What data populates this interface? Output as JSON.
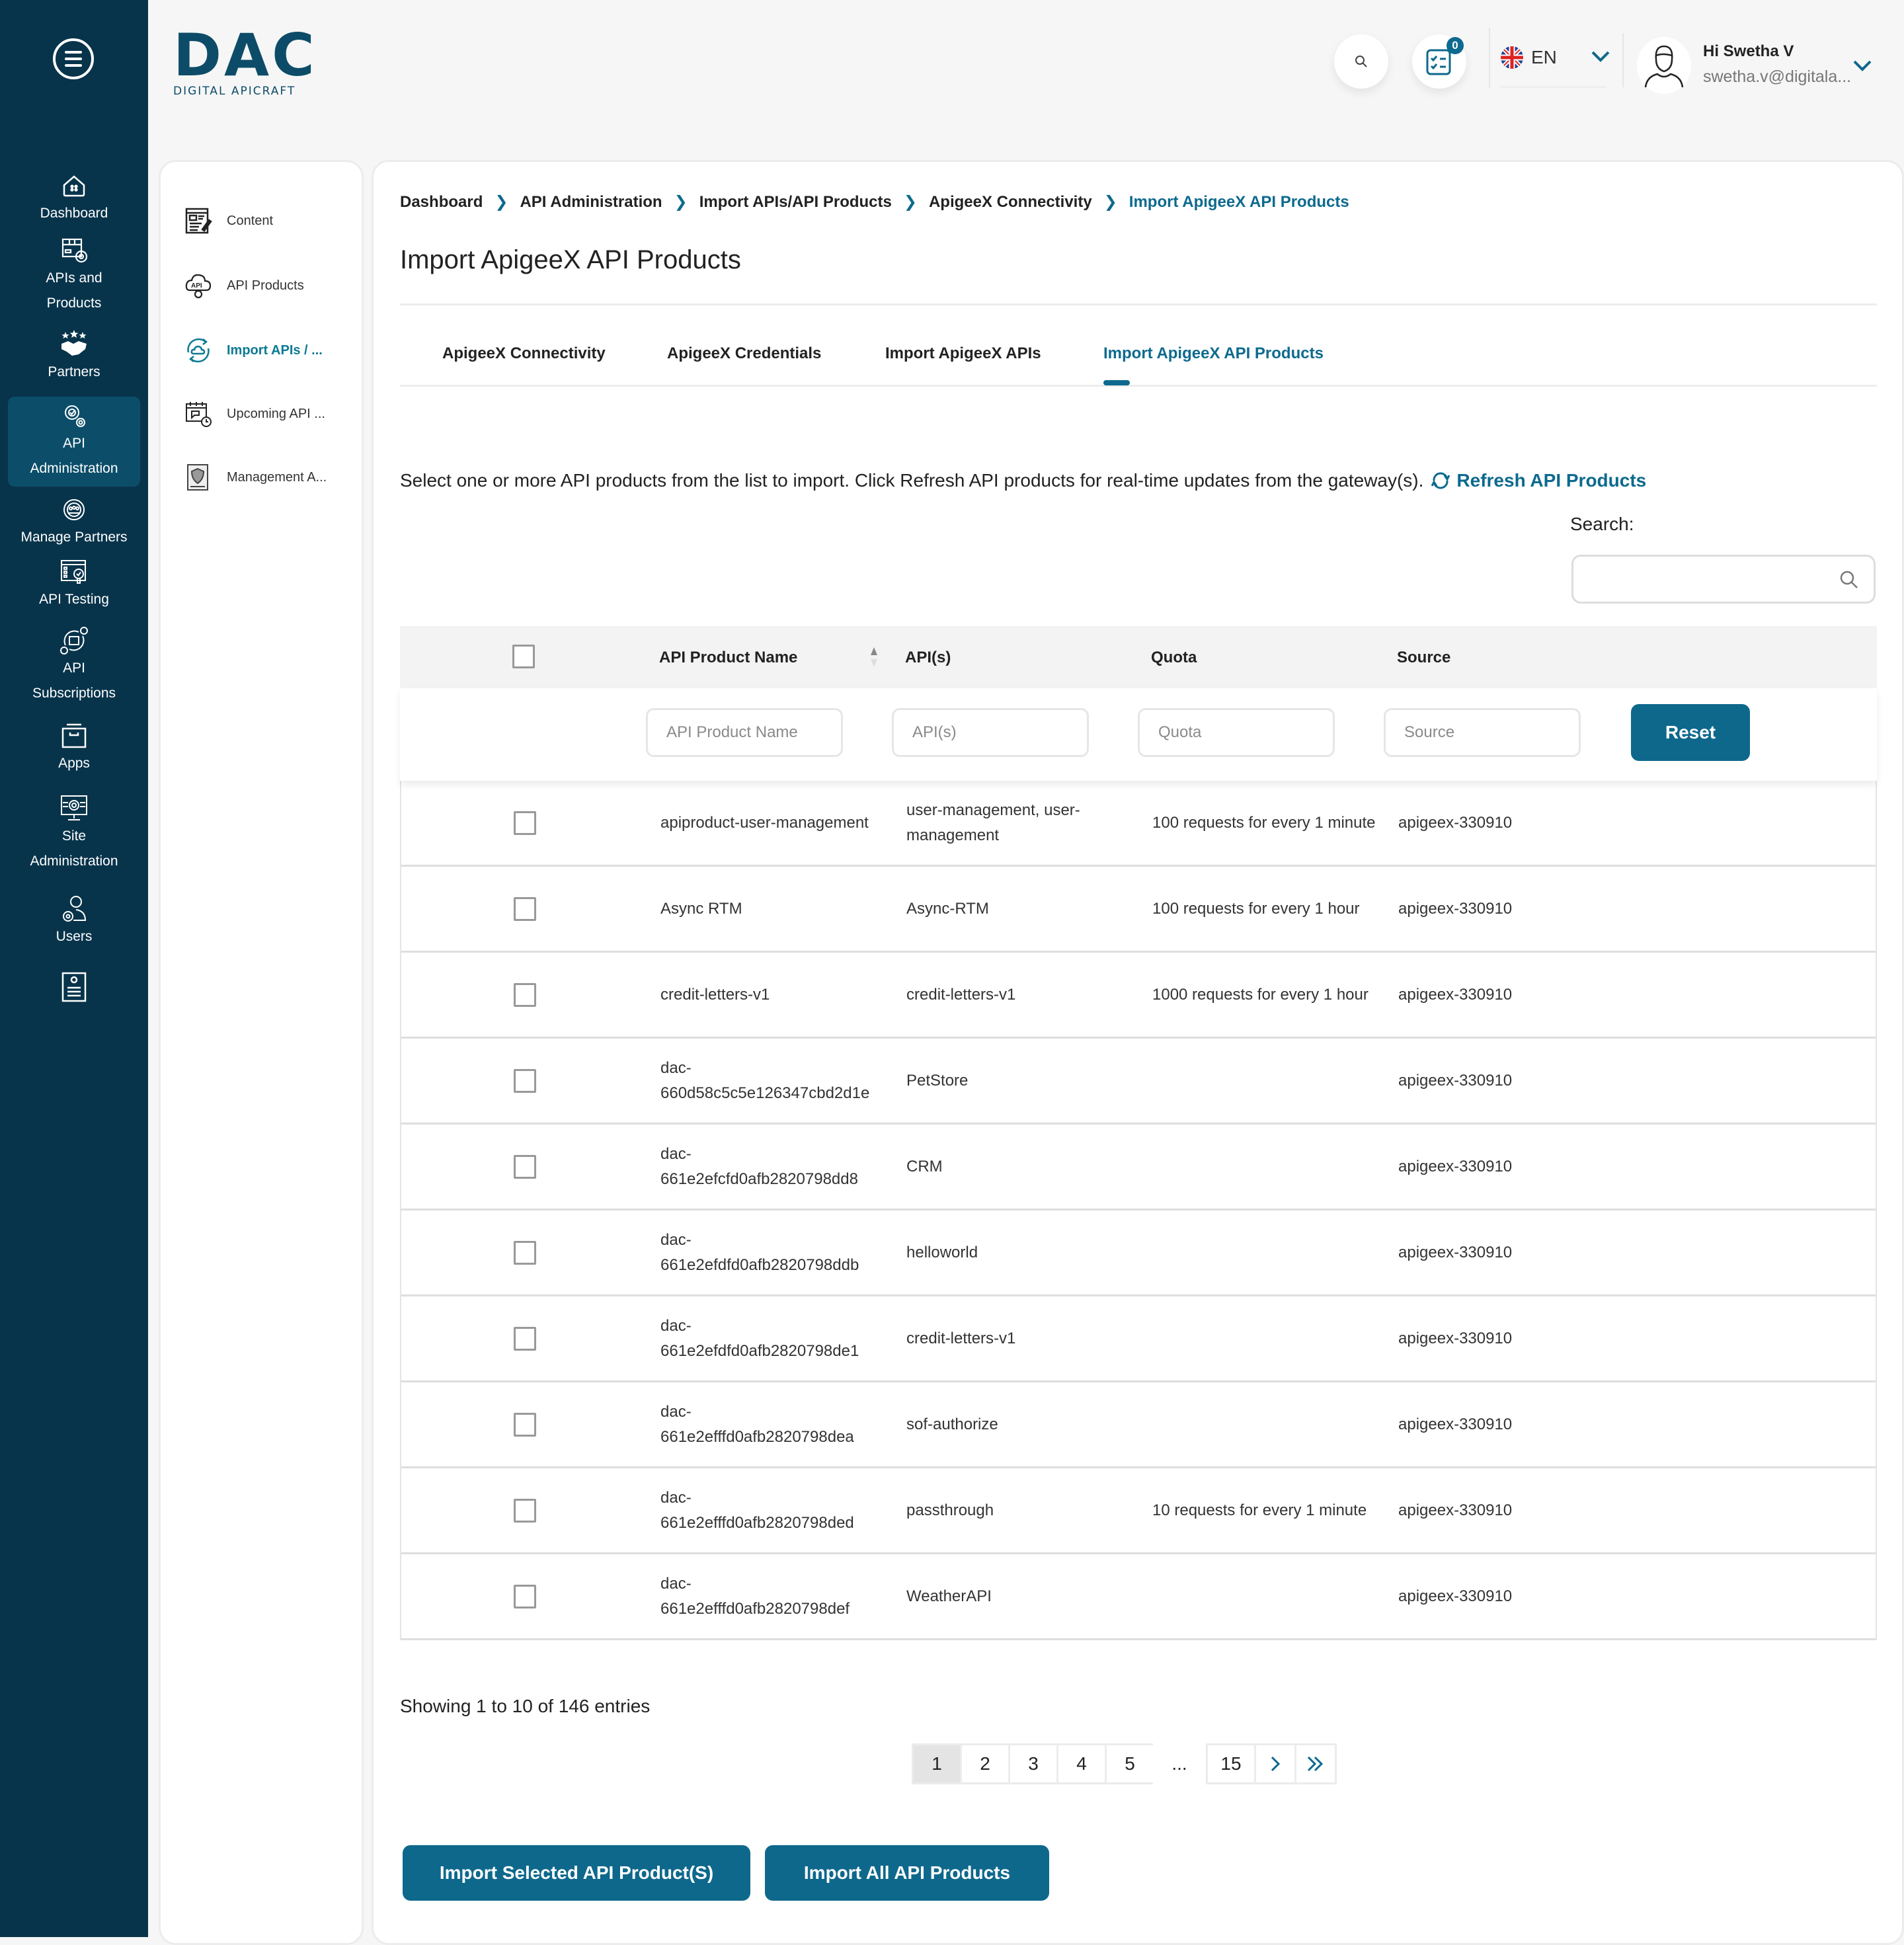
{
  "header": {
    "logo_mark": "DAC",
    "logo_sub": "DIGITAL APICRAFT",
    "notification_count": "0",
    "language": "EN",
    "user_greeting": "Hi Swetha V",
    "user_email": "swetha.v@digitala..."
  },
  "rail": {
    "items": [
      {
        "label": "Dashboard",
        "icon": "home-icon"
      },
      {
        "label": "APIs and Products",
        "icon": "box-gear-icon"
      },
      {
        "label": "Partners",
        "icon": "handshake-icon"
      },
      {
        "label": "API Administration",
        "icon": "gears-icon",
        "active": true
      },
      {
        "label": "Manage Partners",
        "icon": "team-gear-icon"
      },
      {
        "label": "API Testing",
        "icon": "api-testing-icon"
      },
      {
        "label": "API Subscriptions",
        "icon": "subscription-icon"
      },
      {
        "label": "Apps",
        "icon": "apps-icon"
      },
      {
        "label": "Site Administration",
        "icon": "monitor-gear-icon"
      },
      {
        "label": "Users",
        "icon": "user-gear-icon"
      },
      {
        "label": "",
        "icon": "info-document-icon"
      }
    ]
  },
  "subnav": {
    "items": [
      {
        "label": "Content",
        "icon": "content-edit-icon"
      },
      {
        "label": "API Products",
        "icon": "api-cloud-gear-icon"
      },
      {
        "label": "Import APIs / ...",
        "icon": "cloud-sync-icon",
        "active": true
      },
      {
        "label": "Upcoming API ...",
        "icon": "calendar-clock-icon"
      },
      {
        "label": "Management A...",
        "icon": "shield-document-icon"
      }
    ]
  },
  "breadcrumb": [
    "Dashboard",
    "API Administration",
    "Import APIs/API Products",
    "ApigeeX Connectivity",
    "Import ApigeeX API Products"
  ],
  "page_title": "Import ApigeeX API Products",
  "tabs": [
    {
      "label": "ApigeeX Connectivity"
    },
    {
      "label": "ApigeeX Credentials"
    },
    {
      "label": "Import ApigeeX APIs"
    },
    {
      "label": "Import ApigeeX API Products",
      "active": true
    }
  ],
  "intro_text": "Select one or more API products from the list to import. Click Refresh API products for real-time updates from the gateway(s).",
  "refresh_label": "Refresh API Products",
  "search": {
    "label": "Search:",
    "value": "",
    "placeholder": ""
  },
  "table": {
    "columns": [
      "API Product Name",
      "API(s)",
      "Quota",
      "Source"
    ],
    "filters": {
      "name_placeholder": "API Product Name",
      "apis_placeholder": "API(s)",
      "quota_placeholder": "Quota",
      "source_placeholder": "Source",
      "reset_label": "Reset"
    },
    "rows": [
      {
        "name": "apiproduct-user-management",
        "apis": "user-management, user-management",
        "quota": "100 requests for every 1 minute",
        "source": "apigeex-330910"
      },
      {
        "name": "Async RTM",
        "apis": "Async-RTM",
        "quota": "100 requests for every 1 hour",
        "source": "apigeex-330910"
      },
      {
        "name": "credit-letters-v1",
        "apis": "credit-letters-v1",
        "quota": "1000 requests for every 1 hour",
        "source": "apigeex-330910"
      },
      {
        "name": "dac-660d58c5c5e126347cbd2d1e",
        "apis": "PetStore",
        "quota": "",
        "source": "apigeex-330910"
      },
      {
        "name": "dac-661e2efcfd0afb2820798dd8",
        "apis": "CRM",
        "quota": "",
        "source": "apigeex-330910"
      },
      {
        "name": "dac-661e2efdfd0afb2820798ddb",
        "apis": "helloworld",
        "quota": "",
        "source": "apigeex-330910"
      },
      {
        "name": "dac-661e2efdfd0afb2820798de1",
        "apis": "credit-letters-v1",
        "quota": "",
        "source": "apigeex-330910"
      },
      {
        "name": "dac-661e2efffd0afb2820798dea",
        "apis": "sof-authorize",
        "quota": "",
        "source": "apigeex-330910"
      },
      {
        "name": "dac-661e2efffd0afb2820798ded",
        "apis": "passthrough",
        "quota": "10 requests for every 1 minute",
        "source": "apigeex-330910"
      },
      {
        "name": "dac-661e2efffd0afb2820798def",
        "apis": "WeatherAPI",
        "quota": "",
        "source": "apigeex-330910"
      }
    ]
  },
  "pagination": {
    "showing": "Showing 1 to 10 of 146 entries",
    "pages": [
      "1",
      "2",
      "3",
      "4",
      "5"
    ],
    "ellipsis": "...",
    "last_page": "15",
    "current": "1"
  },
  "actions": {
    "import_selected": "Import Selected API Product(S)",
    "import_all": "Import All API Products"
  },
  "colors": {
    "rail_bg": "#08344b",
    "rail_active": "#0c4e69",
    "accent": "#0e688c",
    "link": "#0d6a8e"
  }
}
